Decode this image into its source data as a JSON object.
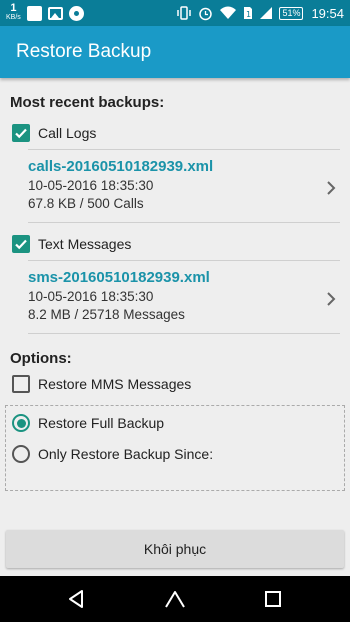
{
  "status_bar": {
    "speed_value": "1",
    "speed_unit": "KB/s",
    "battery": "51%",
    "time": "19:54",
    "icons": [
      "notification-square-icon",
      "image-icon",
      "disc-icon",
      "vibrate-icon",
      "alarm-icon",
      "wifi-icon",
      "sim-icon",
      "signal-icon",
      "battery-icon"
    ]
  },
  "app_bar": {
    "title": "Restore Backup"
  },
  "recent": {
    "heading": "Most recent backups:",
    "call_logs": {
      "label": "Call Logs",
      "checked": true,
      "file": "calls-20160510182939.xml",
      "date": "10-05-2016 18:35:30",
      "size": "67.8 KB / 500 Calls"
    },
    "text_messages": {
      "label": "Text Messages",
      "checked": true,
      "file": "sms-20160510182939.xml",
      "date": "10-05-2016 18:35:30",
      "size": "8.2 MB / 25718 Messages"
    }
  },
  "options": {
    "heading": "Options:",
    "restore_mms": {
      "label": "Restore MMS Messages",
      "checked": false
    },
    "full_backup": {
      "label": "Restore Full Backup",
      "selected": true
    },
    "since": {
      "label": "Only Restore Backup Since:",
      "selected": false
    }
  },
  "restore_button": {
    "label": "Khôi phục"
  },
  "colors": {
    "status_bar": "#0a7d98",
    "app_bar": "#1a9ac7",
    "accent": "#1b9381",
    "file_link": "#1b93a9"
  }
}
